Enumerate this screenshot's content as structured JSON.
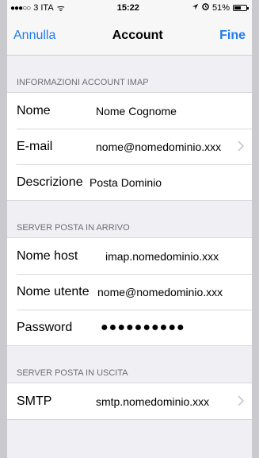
{
  "status": {
    "carrier": "3 ITA",
    "signal": "●●●○○",
    "wifi": "ᯤ",
    "time": "15:22",
    "battery": "51%"
  },
  "nav": {
    "cancel": "Annulla",
    "title": "Account",
    "done": "Fine"
  },
  "imap": {
    "header": "INFORMAZIONI ACCOUNT IMAP",
    "name_label": "Nome",
    "name_value": "Nome Cognome",
    "email_label": "E-mail",
    "email_value": "nome@nomedominio.xxx",
    "desc_label": "Descrizione",
    "desc_value": "Posta Dominio"
  },
  "incoming": {
    "header": "SERVER POSTA IN ARRIVO",
    "host_label": "Nome host",
    "host_value": "imap.nomedominio.xxx",
    "user_label": "Nome utente",
    "user_value": "nome@nomedominio.xxx",
    "password_label": "Password",
    "password_value": "●●●●●●●●●●"
  },
  "outgoing": {
    "header": "SERVER POSTA IN USCITA",
    "smtp_label": "SMTP",
    "smtp_value": "smtp.nomedominio.xxx"
  }
}
